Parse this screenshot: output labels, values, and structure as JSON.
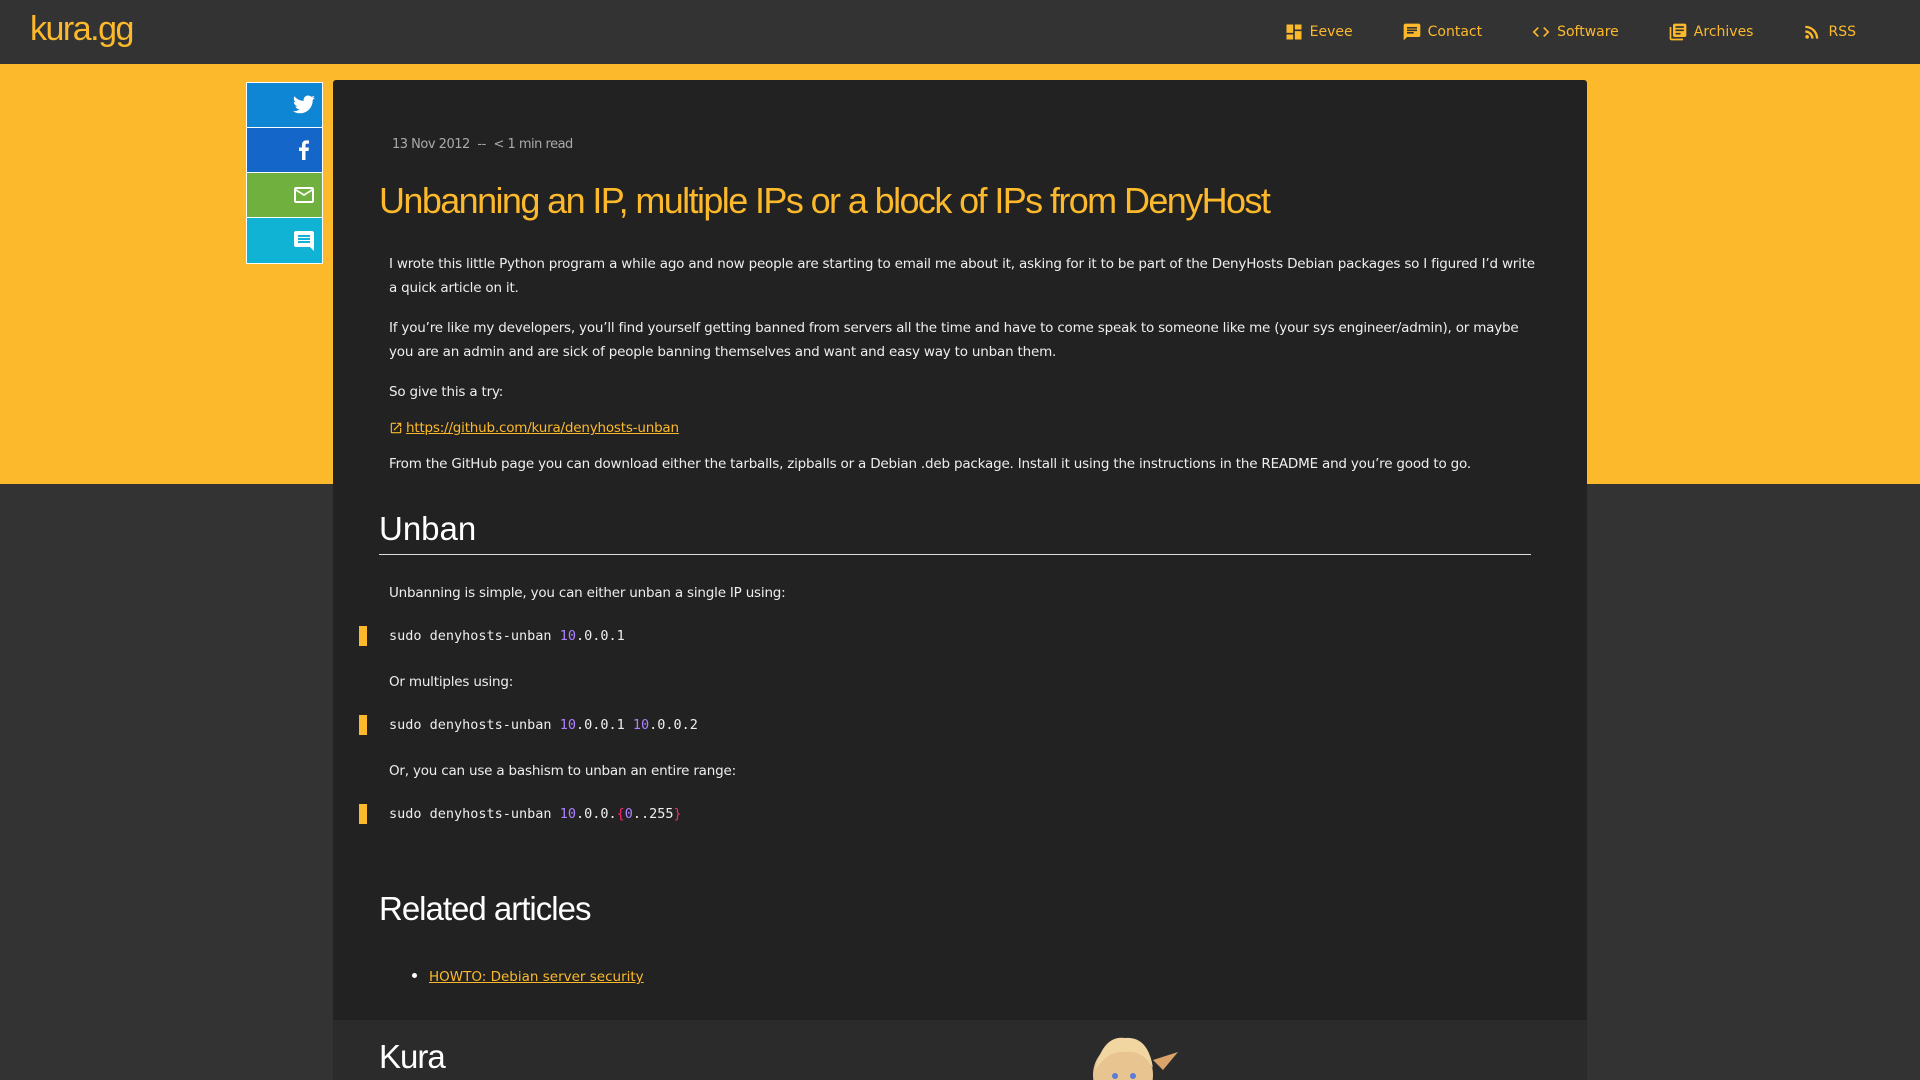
{
  "site": {
    "logo": "kura.gg"
  },
  "nav": [
    {
      "label": "Eevee",
      "icon": "dashboard-icon"
    },
    {
      "label": "Contact",
      "icon": "chat-icon"
    },
    {
      "label": "Software",
      "icon": "code-icon"
    },
    {
      "label": "Archives",
      "icon": "library-icon"
    },
    {
      "label": "RSS",
      "icon": "rss-icon"
    }
  ],
  "share": {
    "twitter": "twitter-icon",
    "facebook": "facebook-icon",
    "email": "email-icon",
    "comment": "comment-icon"
  },
  "article": {
    "date": "13 Nov 2012",
    "separator": "--",
    "read_time": "< 1 min read",
    "title": "Unbanning an IP, multiple IPs or a block of IPs from DenyHost",
    "paragraphs": [
      "I wrote this little Python program a while ago and now people are starting to email me about it, asking for it to be part of the DenyHosts Debian packages so I figured I’d write a quick article on it.",
      "If you’re like my developers, you’ll find yourself getting banned from servers all the time and have to come speak to someone like me (your sys engineer/admin), or maybe you are an admin and are sick of people banning themselves and want and easy way to unban them.",
      "So give this a try:"
    ],
    "link": "https://github.com/kura/denyhosts-unban",
    "after_link": "From the GitHub page you can download either the tarballs, zipballs or a Debian .deb package. Install it using the instructions in the README and you’re good to go.",
    "section_heading": "Unban",
    "unban_intro": "Unbanning is simple, you can either unban a single IP using:",
    "code1": {
      "cmd": "sudo denyhosts-unban ",
      "n1": "10",
      "rest1": ".0.0.1"
    },
    "multiples_text": "Or multiples using:",
    "code2": {
      "cmd": "sudo denyhosts-unban ",
      "n1": "10",
      "rest1": ".0.0.1 ",
      "n2": "10",
      "rest2": ".0.0.2"
    },
    "range_text": "Or, you can use a bashism to unban an entire range:",
    "code3": {
      "cmd": "sudo denyhosts-unban ",
      "n1": "10",
      "rest1": ".0.0.",
      "b1": "{",
      "n2": "0",
      "mid": "..255",
      "b2": "}"
    },
    "related_heading": "Related articles",
    "related": [
      "HOWTO: Debian server security"
    ],
    "author_heading": "Kura"
  },
  "colors": {
    "accent": "#fcb92c",
    "background": "#333333",
    "article_bg": "#222222"
  }
}
